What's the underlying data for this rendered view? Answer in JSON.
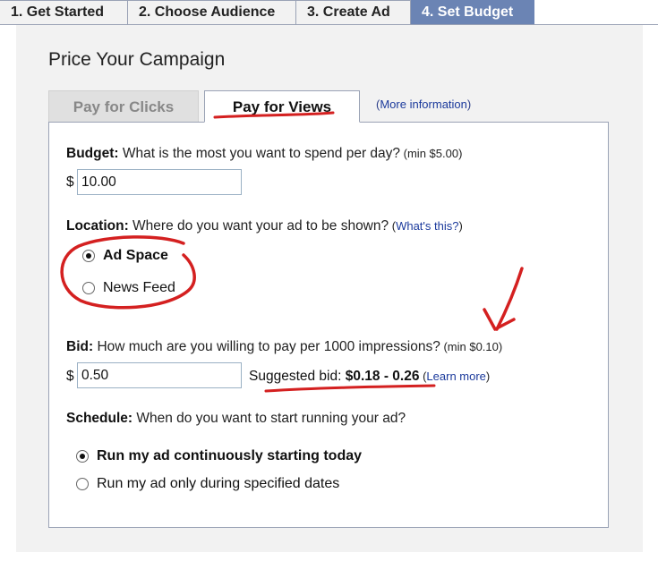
{
  "steps": [
    {
      "label": "1. Get Started"
    },
    {
      "label": "2. Choose Audience"
    },
    {
      "label": "3. Create Ad"
    },
    {
      "label": "4. Set Budget"
    }
  ],
  "page_title": "Price Your Campaign",
  "pricing_tabs": {
    "clicks": "Pay for Clicks",
    "views": "Pay for Views",
    "more_info_open": "(",
    "more_info": "More information",
    "more_info_close": ")"
  },
  "budget": {
    "label": "Budget:",
    "question": " What is the most you want to spend per day?",
    "min": " (min $5.00)",
    "currency": "$",
    "value": "10.00"
  },
  "location": {
    "label": "Location:",
    "question": " Where do you want your ad to be shown?",
    "whats_this_open": " (",
    "whats_this": "What's this?",
    "whats_this_close": ")",
    "options": [
      {
        "label": "Ad Space",
        "selected": true
      },
      {
        "label": "News Feed",
        "selected": false
      }
    ]
  },
  "bid": {
    "label": "Bid:",
    "question": " How much are you willing to pay per 1000 impressions?",
    "min": " (min $0.10)",
    "currency": "$",
    "value": "0.50",
    "suggested_prefix": "Suggested bid: ",
    "suggested_range": "$0.18 - 0.26",
    "learn_more_open": " (",
    "learn_more": "Learn more",
    "learn_more_close": ")"
  },
  "schedule": {
    "label": "Schedule:",
    "question": " When do you want to start running your ad?",
    "options": [
      {
        "label": "Run my ad continuously starting today",
        "selected": true
      },
      {
        "label": "Run my ad only during specified dates",
        "selected": false
      }
    ]
  },
  "colors": {
    "active_step": "#6b84b4",
    "link": "#1b3a9c",
    "annotation": "#d42020"
  }
}
